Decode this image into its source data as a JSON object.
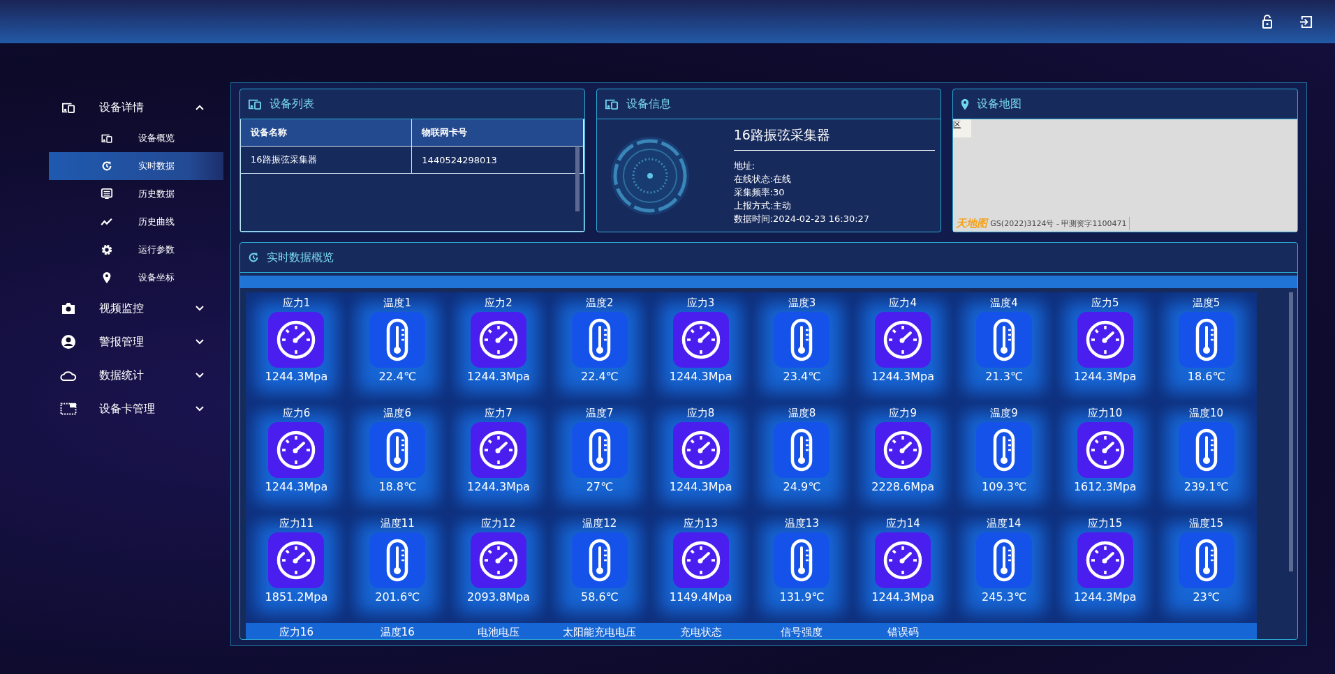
{
  "sidebar": {
    "items": [
      {
        "label": "设备详情",
        "expanded": true,
        "children": [
          {
            "label": "设备概览",
            "selected": false
          },
          {
            "label": "实时数据",
            "selected": true
          },
          {
            "label": "历史数据",
            "selected": false
          },
          {
            "label": "历史曲线",
            "selected": false
          },
          {
            "label": "运行参数",
            "selected": false
          },
          {
            "label": "设备坐标",
            "selected": false
          }
        ]
      },
      {
        "label": "视频监控",
        "expanded": false
      },
      {
        "label": "警报管理",
        "expanded": false
      },
      {
        "label": "数据统计",
        "expanded": false
      },
      {
        "label": "设备卡管理",
        "expanded": false
      }
    ]
  },
  "device_list": {
    "title": "设备列表",
    "columns": [
      "设备名称",
      "物联网卡号"
    ],
    "rows": [
      [
        "16路振弦采集器",
        "1440524298013"
      ]
    ]
  },
  "device_info": {
    "title": "设备信息",
    "name": "16路振弦采集器",
    "lines": [
      "地址:",
      "在线状态:在线",
      "采集频率:30",
      "上报方式:主动",
      "数据时间:2024-02-23 16:30:27"
    ]
  },
  "device_map": {
    "title": "设备地图",
    "tile_label": "区",
    "logo": "天地图",
    "attribution": "GS(2022)3124号 - 甲测资字1100471"
  },
  "realtime": {
    "title": "实时数据概览",
    "tiles": [
      {
        "kind": "stress",
        "label": "应力1",
        "value": "1244.3Mpa"
      },
      {
        "kind": "temperature",
        "label": "温度1",
        "value": "22.4℃"
      },
      {
        "kind": "stress",
        "label": "应力2",
        "value": "1244.3Mpa"
      },
      {
        "kind": "temperature",
        "label": "温度2",
        "value": "22.4℃"
      },
      {
        "kind": "stress",
        "label": "应力3",
        "value": "1244.3Mpa"
      },
      {
        "kind": "temperature",
        "label": "温度3",
        "value": "23.4℃"
      },
      {
        "kind": "stress",
        "label": "应力4",
        "value": "1244.3Mpa"
      },
      {
        "kind": "temperature",
        "label": "温度4",
        "value": "21.3℃"
      },
      {
        "kind": "stress",
        "label": "应力5",
        "value": "1244.3Mpa"
      },
      {
        "kind": "temperature",
        "label": "温度5",
        "value": "18.6℃"
      },
      {
        "kind": "stress",
        "label": "应力6",
        "value": "1244.3Mpa"
      },
      {
        "kind": "temperature",
        "label": "温度6",
        "value": "18.8℃"
      },
      {
        "kind": "stress",
        "label": "应力7",
        "value": "1244.3Mpa"
      },
      {
        "kind": "temperature",
        "label": "温度7",
        "value": "27℃"
      },
      {
        "kind": "stress",
        "label": "应力8",
        "value": "1244.3Mpa"
      },
      {
        "kind": "temperature",
        "label": "温度8",
        "value": "24.9℃"
      },
      {
        "kind": "stress",
        "label": "应力9",
        "value": "2228.6Mpa"
      },
      {
        "kind": "temperature",
        "label": "温度9",
        "value": "109.3℃"
      },
      {
        "kind": "stress",
        "label": "应力10",
        "value": "1612.3Mpa"
      },
      {
        "kind": "temperature",
        "label": "温度10",
        "value": "239.1℃"
      },
      {
        "kind": "stress",
        "label": "应力11",
        "value": "1851.2Mpa"
      },
      {
        "kind": "temperature",
        "label": "温度11",
        "value": "201.6℃"
      },
      {
        "kind": "stress",
        "label": "应力12",
        "value": "2093.8Mpa"
      },
      {
        "kind": "temperature",
        "label": "温度12",
        "value": "58.6℃"
      },
      {
        "kind": "stress",
        "label": "应力13",
        "value": "1149.4Mpa"
      },
      {
        "kind": "temperature",
        "label": "温度13",
        "value": "131.9℃"
      },
      {
        "kind": "stress",
        "label": "应力14",
        "value": "1244.3Mpa"
      },
      {
        "kind": "temperature",
        "label": "温度14",
        "value": "245.3℃"
      },
      {
        "kind": "stress",
        "label": "应力15",
        "value": "1244.3Mpa"
      },
      {
        "kind": "temperature",
        "label": "温度15",
        "value": "23℃"
      }
    ],
    "next_row_labels": [
      "应力16",
      "温度16",
      "电池电压",
      "太阳能充电电压",
      "充电状态",
      "信号强度",
      "错误码"
    ]
  }
}
